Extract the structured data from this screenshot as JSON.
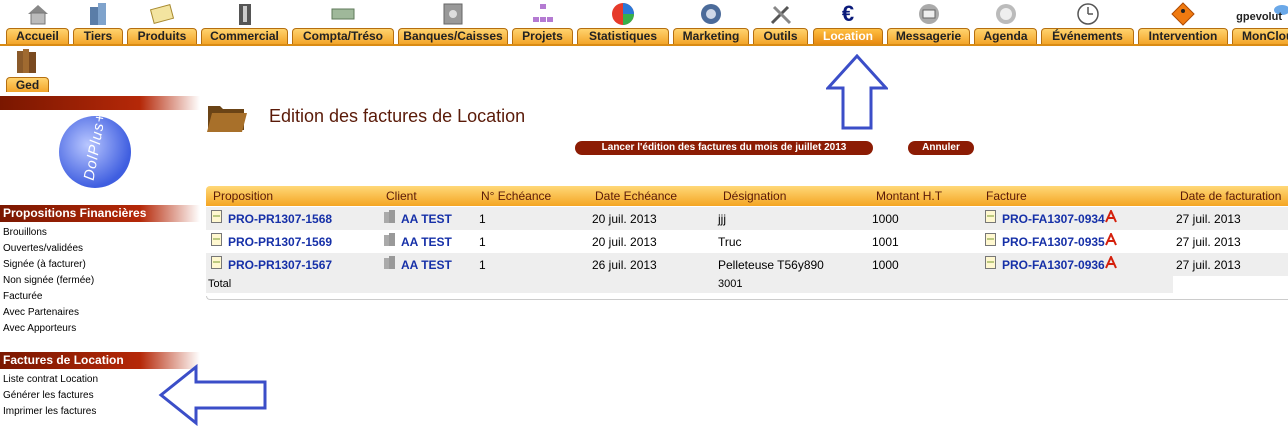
{
  "topnav": {
    "user": "gpevolut",
    "tabs": [
      {
        "label": "Accueil",
        "icon": "house-icon"
      },
      {
        "label": "Tiers",
        "icon": "building-icon"
      },
      {
        "label": "Produits",
        "icon": "product-icon"
      },
      {
        "label": "Commercial",
        "icon": "briefcase-icon"
      },
      {
        "label": "Compta/Tréso",
        "icon": "money-icon"
      },
      {
        "label": "Banques/Caisses",
        "icon": "safe-icon"
      },
      {
        "label": "Projets",
        "icon": "org-chart-icon"
      },
      {
        "label": "Statistiques",
        "icon": "pie-chart-icon"
      },
      {
        "label": "Marketing",
        "icon": "globe-icon"
      },
      {
        "label": "Outils",
        "icon": "tools-icon"
      },
      {
        "label": "Location",
        "icon": "euro-icon"
      },
      {
        "label": "Messagerie",
        "icon": "mail-icon"
      },
      {
        "label": "Agenda",
        "icon": "clock-icon"
      },
      {
        "label": "Événements",
        "icon": "calendar-icon"
      },
      {
        "label": "Intervention",
        "icon": "worker-sign-icon"
      },
      {
        "label": "MonClou",
        "icon": "cloud-icon"
      }
    ],
    "active": "Location",
    "ged_label": "Ged"
  },
  "sidebar": {
    "section1": {
      "title": "Propositions Financières",
      "items": [
        "Brouillons",
        "Ouvertes/validées",
        "Signée (à facturer)",
        "Non signée (fermée)",
        "Facturée",
        "Avec Partenaires",
        "Avec Apporteurs"
      ]
    },
    "section2": {
      "title": "Factures de Location",
      "items": [
        "Liste contrat Location",
        "Générer les factures",
        "Imprimer les factures"
      ]
    },
    "logo_text": "DolPlus+"
  },
  "main": {
    "title": "Edition des factures de Location",
    "launch_button": "Lancer l'édition des factures du mois de juillet 2013",
    "cancel_button": "Annuler",
    "table": {
      "headers": [
        "Proposition",
        "Client",
        "N° Echéance",
        "Date Echéance",
        "Désignation",
        "Montant H.T",
        "Facture",
        "Date de facturation"
      ],
      "rows": [
        {
          "proposition": "PRO-PR1307-1568",
          "client": "AA TEST",
          "echeance": "1",
          "date_echeance": "20 juil. 2013",
          "designation": "jjj",
          "montant": "1000",
          "facture": "PRO-FA1307-0934",
          "date_facturation": "27 juil. 2013"
        },
        {
          "proposition": "PRO-PR1307-1569",
          "client": "AA TEST",
          "echeance": "1",
          "date_echeance": "20 juil. 2013",
          "designation": "Truc",
          "montant": "1001",
          "facture": "PRO-FA1307-0935",
          "date_facturation": "27 juil. 2013"
        },
        {
          "proposition": "PRO-PR1307-1567",
          "client": "AA TEST",
          "echeance": "1",
          "date_echeance": "26 juil. 2013",
          "designation": "Pelleteuse T56y890",
          "montant": "1000",
          "facture": "PRO-FA1307-0936",
          "date_facturation": "27 juil. 2013"
        }
      ],
      "total_label": "Total",
      "total_value": "3001"
    }
  },
  "colors": {
    "tab_orange": "#f3a52a",
    "menu_red": "#b52808",
    "link_blue": "#1630a8",
    "arrow_blue": "#3b4ec8"
  }
}
